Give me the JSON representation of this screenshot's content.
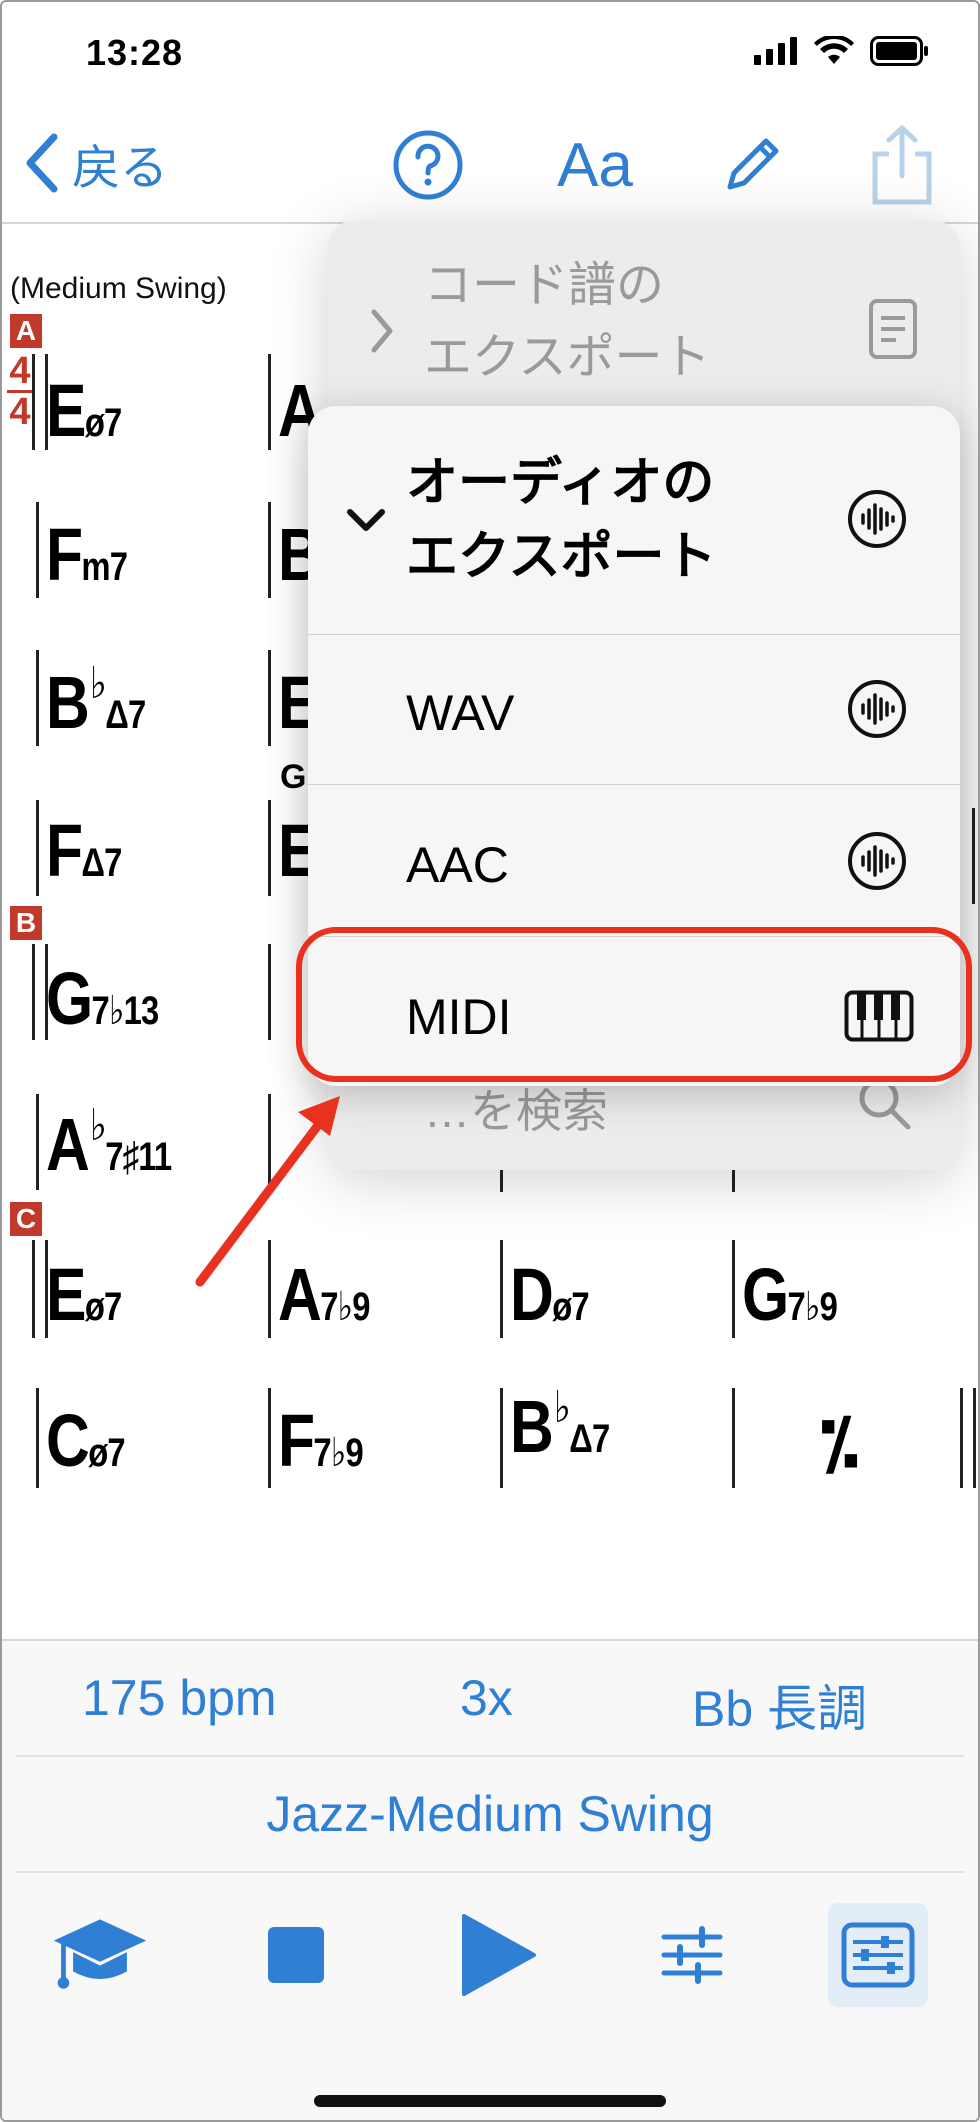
{
  "status_bar": {
    "time": "13:28",
    "icons": [
      "signal-icon",
      "wifi-icon",
      "battery-icon"
    ]
  },
  "nav": {
    "back_label": "戻る",
    "font_button": "Aa",
    "icons": [
      "chevron-left-icon",
      "help-icon",
      "pencil-icon",
      "share-icon"
    ]
  },
  "chart": {
    "style_label": "(Medium Swing)",
    "time_signature": {
      "top": "4",
      "bottom": "4"
    },
    "rehearsal_marks": [
      "A",
      "B",
      "C"
    ],
    "chords": {
      "r1": [
        {
          "root": "E",
          "quality": "ø7"
        },
        {
          "root": "A",
          "quality": ""
        }
      ],
      "r2": [
        {
          "root": "F",
          "quality": "m7"
        },
        {
          "root": "B",
          "quality": ""
        }
      ],
      "r3": [
        {
          "root": "B",
          "acc": "♭",
          "quality": "Δ7"
        },
        {
          "root": "E",
          "quality": ""
        }
      ],
      "r4": [
        {
          "root": "F",
          "quality": "Δ7"
        },
        {
          "root": "E",
          "quality": ""
        }
      ],
      "r4_small": "G",
      "r5": [
        {
          "root": "G",
          "quality": "7♭13"
        }
      ],
      "r6": [
        {
          "root": "A",
          "acc": "♭",
          "quality": "7♯11"
        }
      ],
      "r7": [
        {
          "root": "E",
          "quality": "ø7"
        },
        {
          "root": "A",
          "quality": "7♭9"
        },
        {
          "root": "D",
          "quality": "ø7"
        },
        {
          "root": "G",
          "quality": "7♭9"
        }
      ],
      "r8": [
        {
          "root": "C",
          "quality": "ø7"
        },
        {
          "root": "F",
          "quality": "7♭9"
        },
        {
          "root": "B",
          "acc": "♭",
          "quality": "Δ7"
        }
      ],
      "repeat_symbol": "⁒"
    }
  },
  "menu": {
    "back_item": "コード譜の\nエクスポート",
    "back_item_line1": "コード譜の",
    "back_item_line2": "エクスポート",
    "search_placeholder": "…を検索",
    "submenu_title_line1": "オーディオの",
    "submenu_title_line2": "エクスポート",
    "items": [
      {
        "label": "WAV",
        "icon": "waveform-icon"
      },
      {
        "label": "AAC",
        "icon": "waveform-icon"
      },
      {
        "label": "MIDI",
        "icon": "piano-keys-icon"
      }
    ],
    "highlighted": "MIDI",
    "highlight_color": "#e8321f"
  },
  "footer": {
    "tempo": "175 bpm",
    "repeats": "3x",
    "key": "Bb 長調",
    "style": "Jazz-Medium Swing",
    "tools": [
      "graduation-cap-icon",
      "stop-icon",
      "play-icon",
      "sliders-icon",
      "mixer-icon"
    ],
    "accent_color": "#2f7fd4"
  }
}
